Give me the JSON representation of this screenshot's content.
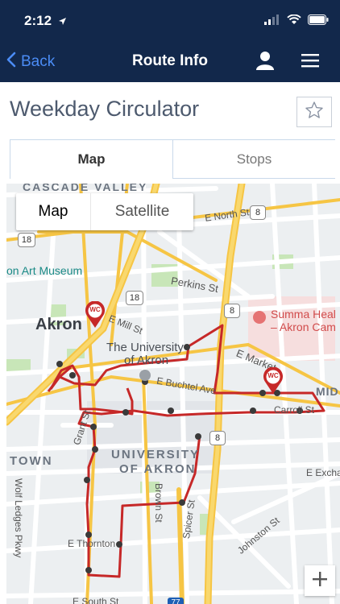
{
  "status": {
    "time": "2:12"
  },
  "nav": {
    "back_label": "Back",
    "title": "Route Info"
  },
  "route": {
    "name": "Weekday Circulator"
  },
  "tabs": {
    "map": "Map",
    "stops": "Stops"
  },
  "map_controls": {
    "map": "Map",
    "satellite": "Satellite"
  },
  "map_labels": {
    "cascade_valley": "CASCADE VALLEY",
    "e_north_st": "E North St",
    "art_museum": "on Art Museum",
    "perkins_st": "Perkins St",
    "summa_1": "Summa Heal",
    "summa_2": "– Akron Cam",
    "akron": "Akron",
    "e_mill_st": "E Mill St",
    "university_1": "The University",
    "university_2": "of Akron",
    "e_market_st": "E Market",
    "mid": "MID",
    "e_buchtel_ave": "E Buchtel Ave",
    "carroll_st": "Carroll St",
    "town": "TOWN",
    "ua_1": "UNIVERSITY",
    "ua_2": "OF AKRON",
    "e_exchange": "E Excha",
    "grant_st": "Grant St",
    "wolf_ledges": "Wolf Ledges Pkwy",
    "brown_st": "Brown St",
    "spicer_st": "Spicer St",
    "johnston_st": "Johnston St",
    "e_thornton": "E Thornton",
    "e_south_st": "E South St",
    "route_18_a": "18",
    "route_18_b": "18",
    "route_8_a": "8",
    "route_8_b": "8",
    "route_8_c": "8",
    "route_77": "77",
    "marker_wc": "WC"
  },
  "colors": {
    "nav_bg": "#12284b",
    "accent": "#4b8cf5",
    "route": "#c62828",
    "highway": "#f6c544"
  },
  "icons": {
    "back": "chevron-left-icon",
    "user": "user-icon",
    "menu": "hamburger-icon",
    "favorite": "star-outline-icon",
    "zoom": "plus-icon"
  }
}
